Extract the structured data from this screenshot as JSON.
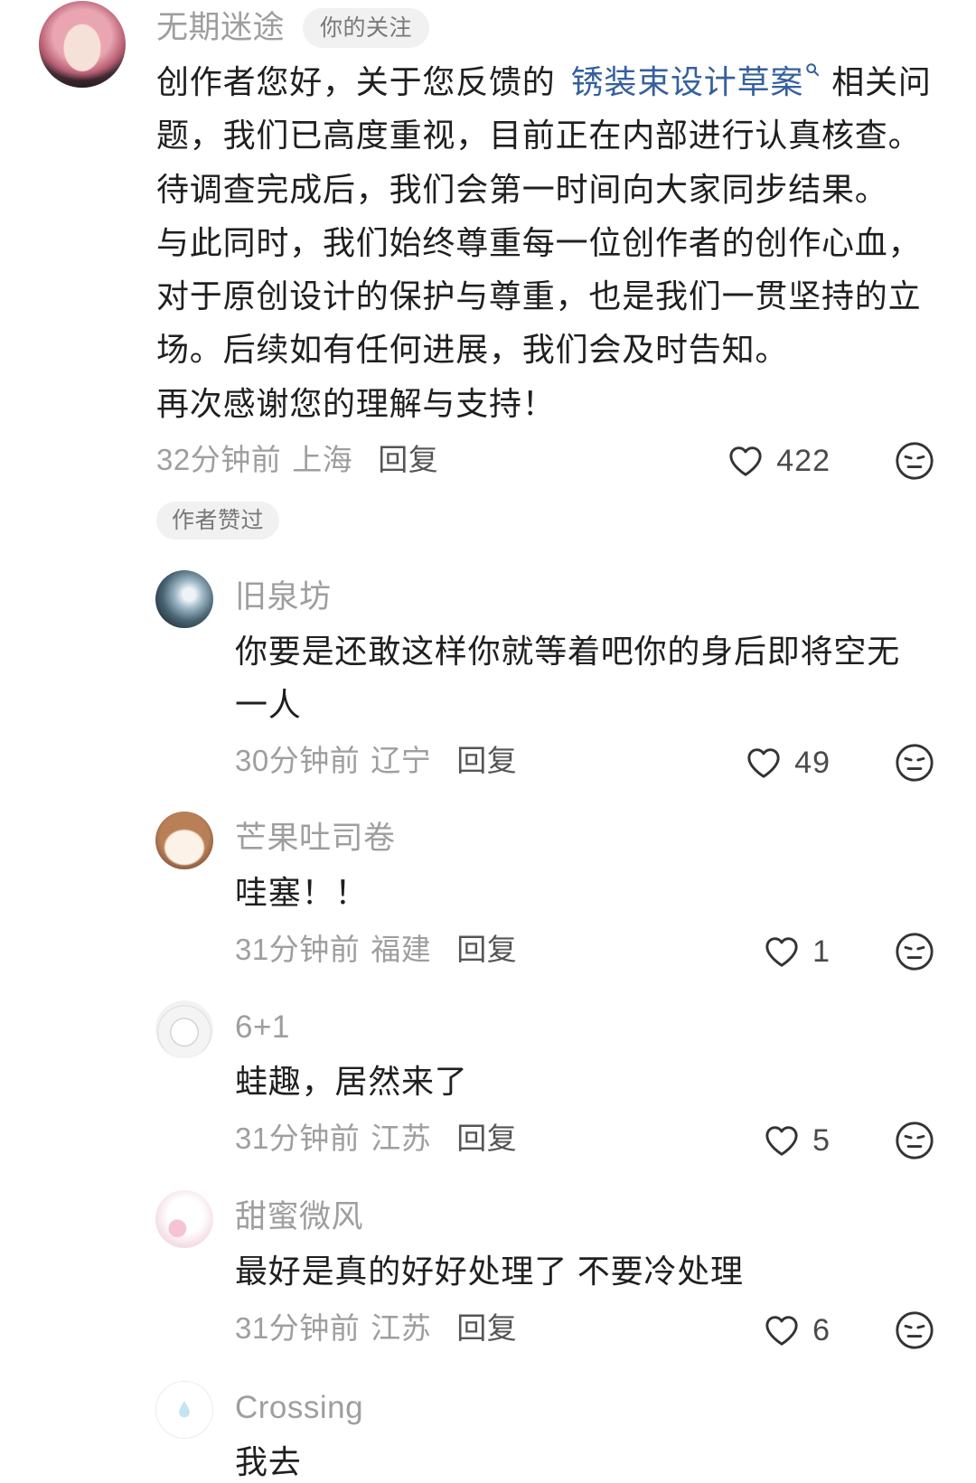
{
  "comment": {
    "author": "无期迷途",
    "author_badge": "你的关注",
    "body": {
      "line1_prefix": "创作者您好，关于您反馈的",
      "topic_link": "锈装束设计草案",
      "line1_suffix": "相关问",
      "lines": [
        "题，我们已高度重视，目前正在内部进行认真核查。",
        "待调查完成后，我们会第一时间向大家同步结果。",
        "与此同时，我们始终尊重每一位创作者的创作心血，",
        "对于原创设计的保护与尊重，也是我们一贯坚持的立",
        "场。后续如有任何进展，我们会及时告知。",
        "再次感谢您的理解与支持！"
      ]
    },
    "time": "32分钟前",
    "location": "上海",
    "reply_label": "回复",
    "likes": "422",
    "author_liked_badge": "作者赞过"
  },
  "replies": [
    {
      "author": "旧泉坊",
      "lines": [
        "你要是还敢这样你就等着吧你的身后即将空无",
        "一人"
      ],
      "time": "30分钟前",
      "location": "辽宁",
      "reply_label": "回复",
      "likes": "49"
    },
    {
      "author": "芒果吐司卷",
      "lines": [
        "哇塞！！"
      ],
      "time": "31分钟前",
      "location": "福建",
      "reply_label": "回复",
      "likes": "1"
    },
    {
      "author": "6+1",
      "lines": [
        "蛙趣，居然来了"
      ],
      "time": "31分钟前",
      "location": "江苏",
      "reply_label": "回复",
      "likes": "5"
    },
    {
      "author": "甜蜜微风",
      "lines": [
        "最好是真的好好处理了 不要冷处理"
      ],
      "time": "31分钟前",
      "location": "江苏",
      "reply_label": "回复",
      "likes": "6"
    },
    {
      "author": "Crossing",
      "lines": [
        "我去"
      ]
    }
  ],
  "icons": {
    "like": "heart-icon",
    "dislike": "meh-face-icon",
    "topic_search": "search-icon",
    "crossing_avatar": "water-drop-icon"
  },
  "colors": {
    "background": "#ffffff",
    "text": "#1f1f1f",
    "secondary_text": "#9e9e9e",
    "reply_action": "#555555",
    "like_count": "#4a4a4a",
    "link": "#35609c",
    "badge_background": "#f1f1f1",
    "badge_text": "#787878"
  }
}
